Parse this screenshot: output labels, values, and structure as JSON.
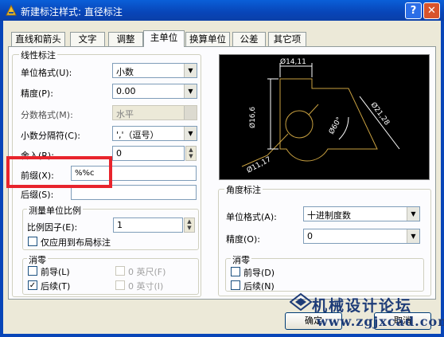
{
  "window": {
    "title": "新建标注样式: 直径标注",
    "help": "?",
    "close": "✕"
  },
  "tabs": [
    {
      "label": "直线和箭头"
    },
    {
      "label": "文字"
    },
    {
      "label": "调整"
    },
    {
      "label": "主单位",
      "active": true
    },
    {
      "label": "换算单位"
    },
    {
      "label": "公差"
    },
    {
      "label": "其它项"
    }
  ],
  "linear": {
    "title": "线性标注",
    "unit_format": {
      "label": "单位格式(U):",
      "value": "小数"
    },
    "precision": {
      "label": "精度(P):",
      "value": "0.00"
    },
    "fraction_format": {
      "label": "分数格式(M):",
      "value": "水平"
    },
    "decimal_separator": {
      "label": "小数分隔符(C):",
      "value": "','（逗号）"
    },
    "round_off": {
      "label": "舍入(R):",
      "value": "0"
    },
    "prefix": {
      "label": "前缀(X):",
      "value": "%%c"
    },
    "suffix": {
      "label": "后缀(S):",
      "value": ""
    },
    "scale": {
      "title": "测量单位比例",
      "factor": {
        "label": "比例因子(E):",
        "value": "1"
      },
      "layout_only": "仅应用到布局标注"
    },
    "zero_suppression": {
      "title": "消零",
      "leading": "前导(L)",
      "trailing": "后续(T)",
      "feet": "0 英尺(F)",
      "inches": "0 英寸(I)",
      "leading_checked": false,
      "trailing_checked": true
    }
  },
  "angular": {
    "title": "角度标注",
    "unit_format": {
      "label": "单位格式(A):",
      "value": "十进制度数"
    },
    "precision": {
      "label": "精度(O):",
      "value": "0"
    },
    "zero_suppression": {
      "title": "消零",
      "leading": "前导(D)",
      "trailing": "后续(N)"
    }
  },
  "preview": {
    "dim_top": "Ø14,11",
    "dim_left": "Ø16,6",
    "dim_right": "Ø21,28",
    "dim_angle": "Ø60°",
    "dim_bottom": "Ø11,17"
  },
  "buttons": {
    "ok": "确定",
    "cancel": "取消"
  },
  "watermark": {
    "cn": "机械设计论坛",
    "url": "www.zgjxcad.com"
  },
  "colors": {
    "preview_lines": "#c8a040",
    "preview_text": "#ffffff",
    "highlight": "#e8242c"
  }
}
